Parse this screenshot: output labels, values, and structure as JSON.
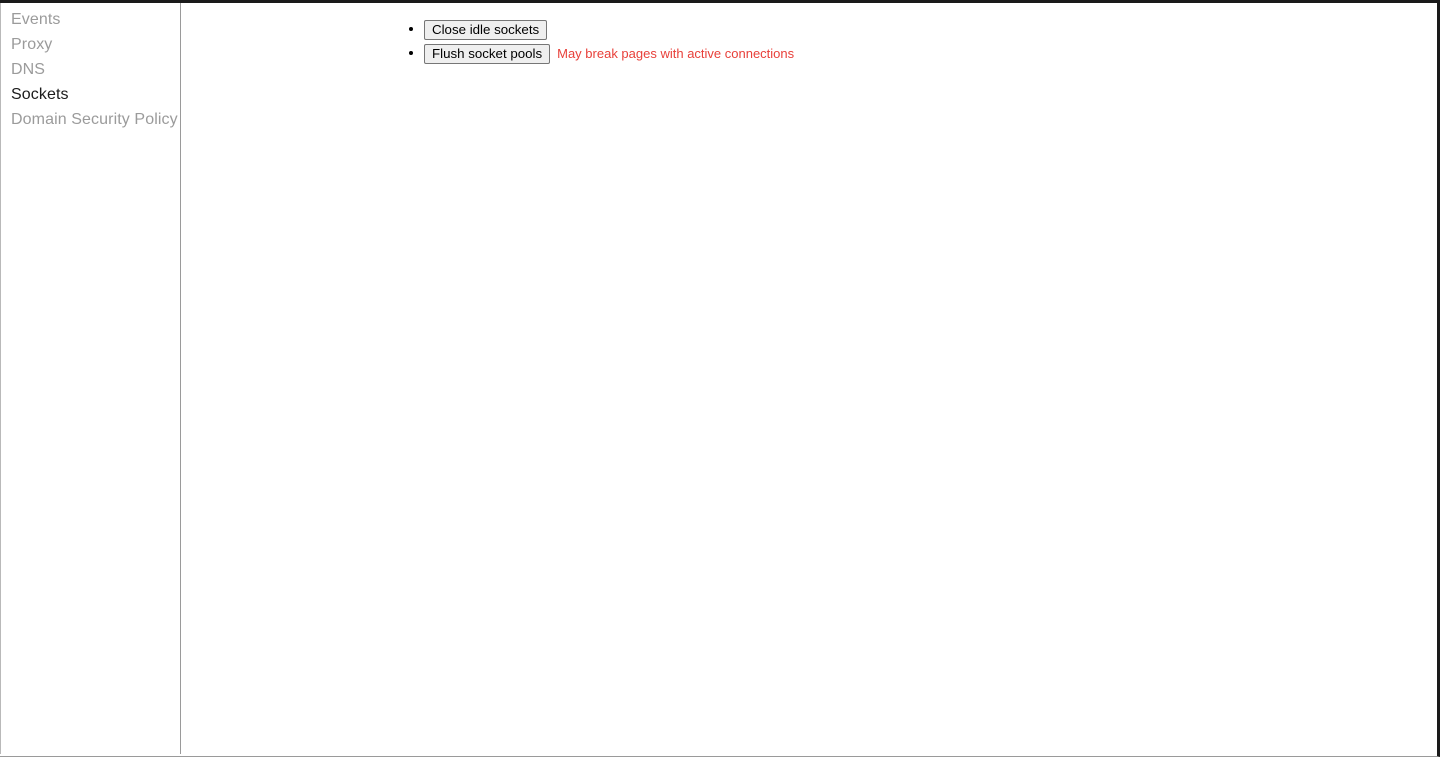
{
  "sidebar": {
    "items": [
      {
        "label": "Events",
        "active": false
      },
      {
        "label": "Proxy",
        "active": false
      },
      {
        "label": "DNS",
        "active": false
      },
      {
        "label": "Sockets",
        "active": true
      },
      {
        "label": "Domain Security Policy",
        "active": false
      }
    ]
  },
  "main": {
    "actions": [
      {
        "button_label": "Close idle sockets",
        "warning": ""
      },
      {
        "button_label": "Flush socket pools",
        "warning": "May break pages with active connections"
      }
    ]
  },
  "colors": {
    "warning": "#e8403a",
    "nav_inactive": "#9b9b9b",
    "nav_active": "#1b1b1b",
    "button_face": "#efefef",
    "button_border": "#767676"
  }
}
